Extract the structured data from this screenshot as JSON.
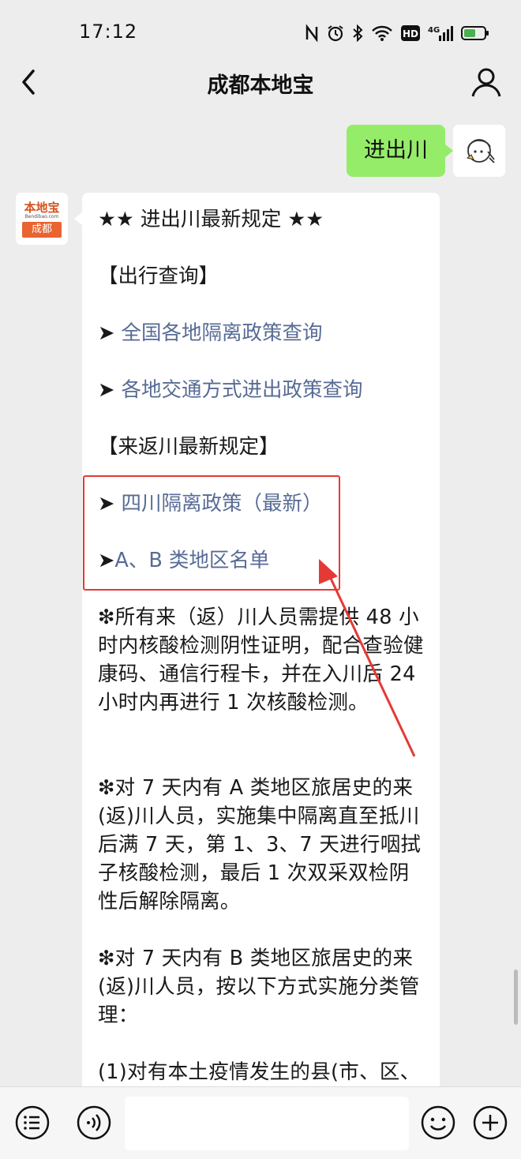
{
  "status_bar": {
    "time": "17:12",
    "icons": [
      "nfc-icon",
      "alarm-icon",
      "bluetooth-icon",
      "wifi-icon",
      "hd-icon",
      "signal-4g-icon",
      "battery-icon"
    ],
    "hd_label": "HD",
    "network_label": "4G"
  },
  "nav": {
    "title": "成都本地宝"
  },
  "chat": {
    "sent_message": "进出川",
    "bot_avatar": {
      "logo_text": "本地宝",
      "logo_sub": "Bendibao.com",
      "city": "成都"
    },
    "reply": {
      "title": "★★ 进出川最新规定 ★★",
      "section_travel": "【出行查询】",
      "link_quarantine_arrow": "➤ ",
      "link_quarantine": "全国各地隔离政策查询",
      "link_transport_arrow": "➤ ",
      "link_transport": "各地交通方式进出政策查询",
      "section_sichuan": "【来返川最新规定】",
      "link_sichuan_arrow": "➤ ",
      "link_sichuan": "四川隔离政策（最新）",
      "link_ab_arrow": "➤",
      "link_ab": "A、B 类地区名单",
      "para1": "❇所有来（返）川人员需提供 48 小时内核酸检测阴性证明，配合查验健康码、通信行程卡，并在入川后 24 小时内再进行 1 次核酸检测。",
      "para2": "❇对 7 天内有 A 类地区旅居史的来(返)川人员，实施集中隔离直至抵川后满 7 天，第 1、3、7 天进行咽拭子核酸检测，最后 1 次双采双检阴性后解除隔离。",
      "para3": "❇对 7 天内有 B 类地区旅居史的来(返)川人员，按以下方式实施分类管理：",
      "para4": "(1)对有本土疫情发生的县(市、区、"
    }
  },
  "colors": {
    "background": "#ededed",
    "sent_bubble": "#95ec69",
    "link": "#576b95",
    "annotation_red": "#e53935"
  }
}
